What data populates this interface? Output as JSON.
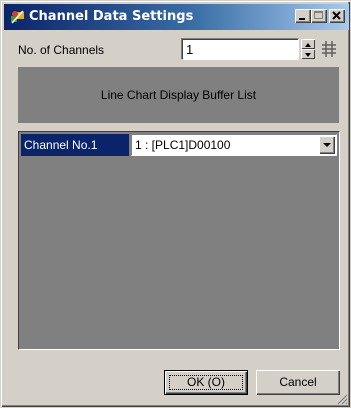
{
  "window": {
    "title": "Channel Data Settings"
  },
  "settings": {
    "channels_label": "No. of Channels",
    "channels_value": "1"
  },
  "buffer": {
    "header": "Line Chart Display Buffer List"
  },
  "rows": [
    {
      "label": "Channel No.1",
      "value": "1 : [PLC1]D00100"
    }
  ],
  "buttons": {
    "ok": "OK (O)",
    "cancel": "Cancel"
  },
  "colors": {
    "title_start": "#0a246a",
    "title_end": "#a6caf0",
    "face": "#d4d0c8",
    "selected": "#0a246a"
  }
}
